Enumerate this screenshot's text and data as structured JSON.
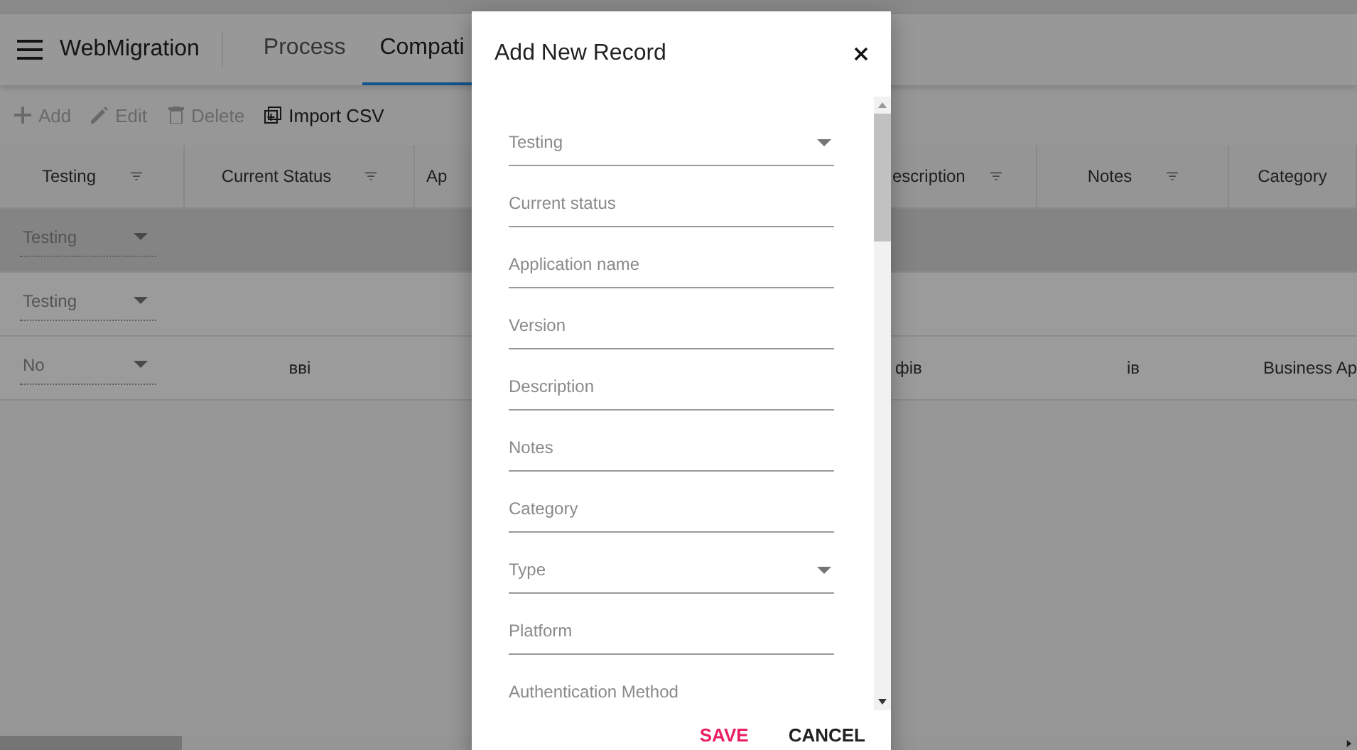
{
  "app": {
    "title": "WebMigration",
    "tabs": [
      {
        "label": "Process",
        "selected": false
      },
      {
        "label": "Compati",
        "selected": true
      }
    ],
    "toolbar": [
      {
        "label": "Add",
        "kind": "plus",
        "disabled": true
      },
      {
        "label": "Edit",
        "kind": "pencil",
        "disabled": true
      },
      {
        "label": "Delete",
        "kind": "trash",
        "disabled": true
      },
      {
        "label": "Import CSV",
        "kind": "import",
        "disabled": false
      }
    ]
  },
  "table": {
    "columns": [
      {
        "label": "Testing",
        "filter": true
      },
      {
        "label": "Current Status",
        "filter": true
      },
      {
        "label": "Ap"
      },
      {
        "label": "escription",
        "filter": true
      },
      {
        "label": "Notes",
        "filter": true
      },
      {
        "label": "Category"
      }
    ],
    "rows": [
      {
        "selected": true,
        "testing": "Testing"
      },
      {
        "selected": false,
        "testing": "Testing"
      },
      {
        "selected": false,
        "testing": "No",
        "current_status": "вві",
        "description": "фів",
        "notes": "ів",
        "category": "Business Ap"
      }
    ]
  },
  "dialog": {
    "title": "Add New Record",
    "fields": [
      {
        "placeholder": "Testing",
        "kind": "select"
      },
      {
        "placeholder": "Current status",
        "kind": "text"
      },
      {
        "placeholder": "Application name",
        "kind": "text"
      },
      {
        "placeholder": "Version",
        "kind": "text"
      },
      {
        "placeholder": "Description",
        "kind": "text"
      },
      {
        "placeholder": "Notes",
        "kind": "text"
      },
      {
        "placeholder": "Category",
        "kind": "text"
      },
      {
        "placeholder": "Type",
        "kind": "select"
      },
      {
        "placeholder": "Platform",
        "kind": "text"
      },
      {
        "placeholder": "Authentication Method",
        "kind": "text"
      }
    ],
    "buttons": [
      {
        "label": "SAVE",
        "kind": "primary"
      },
      {
        "label": "CANCEL",
        "kind": "plain"
      }
    ]
  }
}
